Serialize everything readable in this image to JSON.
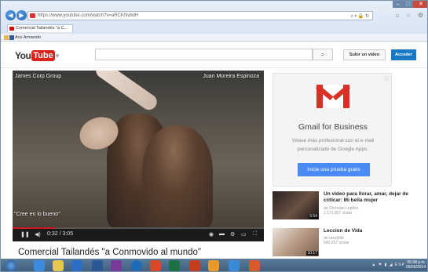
{
  "browser": {
    "url": "https://www.youtube.com/watch?v=aRCKNvbdH",
    "tab_title": "Comercial Tailandés \"a C...",
    "favorite": "Ace Armando"
  },
  "youtube": {
    "logo_you": "You",
    "logo_tube": "Tube",
    "search_placeholder": "",
    "upload_label": "Subir un video",
    "signin_label": "Acceder"
  },
  "video": {
    "overlay_left": "James Corp Group",
    "overlay_right": "Juan Moreira Espinoza",
    "subtitle": "\"Cree en lo bueno\"",
    "time": "0:32 / 3:05",
    "progress": 0.17,
    "title": "Comercial Tailandés \"a Conmovido al mundo\""
  },
  "ad": {
    "title": "Gmail for Business",
    "body": "Véase más profesional con el e-mail personalizado de Google Apps.",
    "cta": "Inicie una prueba gratis"
  },
  "related": [
    {
      "title": "Un video para llorar, amar, dejar de criticar: Mi bella mujer",
      "channel": "de Chrisvan Lopitos",
      "views": "2.171.807 vistas",
      "duration": "6:54"
    },
    {
      "title": "Leccion de Vida",
      "channel": "de rasoji/tbl",
      "views": "540.257 vistas",
      "duration": "10:17"
    }
  ],
  "taskbar": {
    "lang": "ESP",
    "time": "05:38 p.m.",
    "date": "06/06/2014"
  },
  "colors": {
    "youtube_red": "#d9231c",
    "signin_blue": "#167ac6",
    "ad_button": "#4a8af4",
    "progress_red": "#cc181e"
  }
}
